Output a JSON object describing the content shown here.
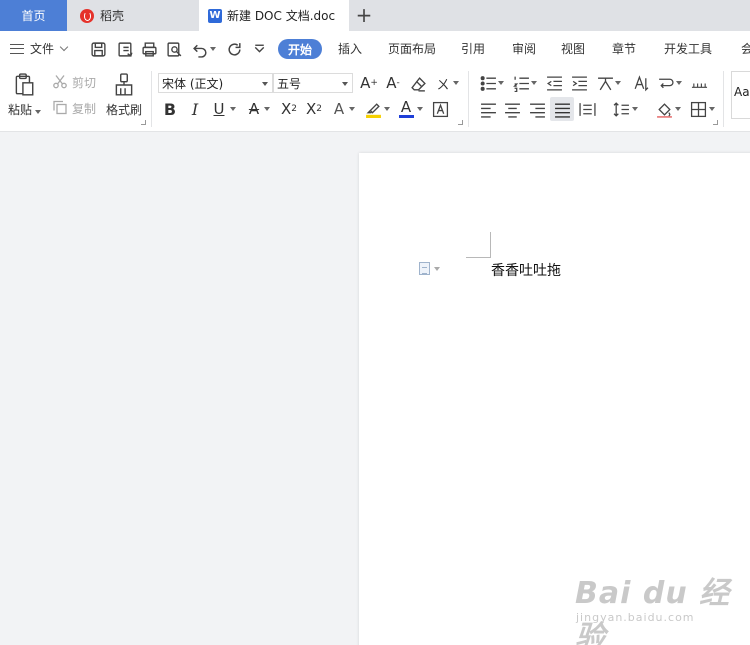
{
  "tabs": {
    "home": "首页",
    "daoke": "稻壳",
    "doc": "新建 DOC 文档.doc",
    "doc_icon": "W"
  },
  "menu": {
    "file": "文件",
    "tabs": [
      "开始",
      "插入",
      "页面布局",
      "引用",
      "审阅",
      "视图",
      "章节",
      "开发工具",
      "会"
    ]
  },
  "ribbon": {
    "paste": "粘贴",
    "cut": "剪切",
    "copy": "复制",
    "format_painter": "格式刷",
    "font_name": "宋体 (正文)",
    "font_size": "五号",
    "style_preview": "AaI"
  },
  "document": {
    "text": "香香吐吐拖"
  },
  "watermark": {
    "brand": "Bai du 经验",
    "url": "jingyan.baidu.com"
  },
  "colors": {
    "accent": "#4d7fd6",
    "highlight": "#f5d000",
    "font_color": "#1f3fd8"
  }
}
